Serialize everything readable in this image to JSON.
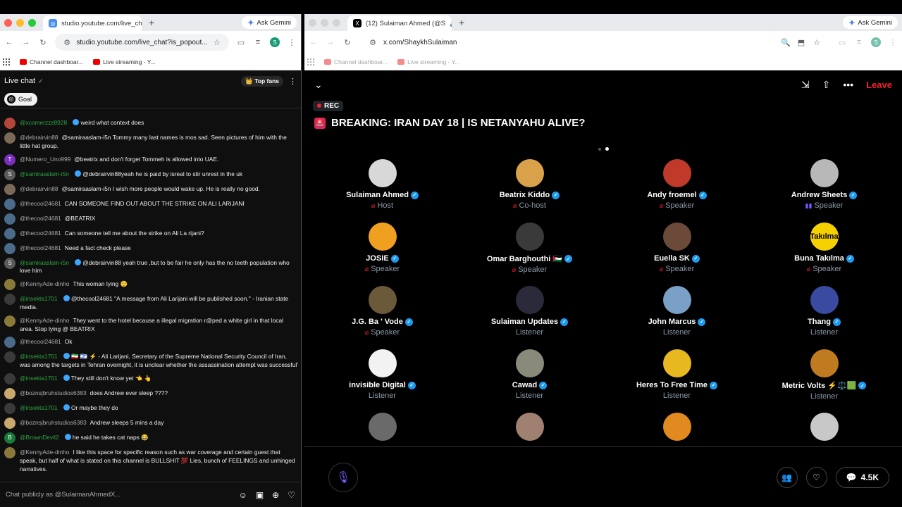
{
  "left_browser": {
    "tab_title": "studio.youtube.com/live_chat",
    "url": "studio.youtube.com/live_chat?is_popout...",
    "ask_gemini": "Ask Gemini",
    "avatar_letter": "S",
    "bookmarks": [
      "Channel dashboar...",
      "Live streaming - Y..."
    ]
  },
  "right_browser": {
    "tab_title": "(12) Sulaiman Ahmed (@S",
    "url": "x.com/ShaykhSulaiman",
    "ask_gemini": "Ask Gemini",
    "avatar_letter": "S",
    "bookmarks": [
      "Channel dashboar...",
      "Live streaming - Y..."
    ]
  },
  "chat": {
    "title": "Live chat",
    "top_fans": "Top fans",
    "goal": "Goal",
    "input_placeholder": "Chat publicly as @SulaimanAhmedX...",
    "messages": [
      {
        "user": "@xcomerzzz8928",
        "green": true,
        "verified": true,
        "text": "weird what context does",
        "color": "#b5463a"
      },
      {
        "user": "@debrairvin88",
        "green": false,
        "verified": false,
        "text": "@samiraaslam-i5n Tommy many last names is mos sad. Seen pictures of him with the little hat group.",
        "color": "#7b6a58"
      },
      {
        "user": "@Numero_Uno999",
        "green": false,
        "verified": false,
        "text": "@beatrix and don't forget Tommeh is allowed into UAE.",
        "color": "#7b2fbe",
        "letter": "T"
      },
      {
        "user": "@samiraaslam-i5n",
        "green": true,
        "verified": true,
        "text": "@debrairvin88yeah he is paid by isreal to stir unrest in the uk",
        "color": "#5a5a5a",
        "letter": "S"
      },
      {
        "user": "@debrairvin88",
        "green": false,
        "verified": false,
        "text": "@samiraaslam-i5n I wish more people would wake up. He is really no good.",
        "color": "#7b6a58"
      },
      {
        "user": "@thecool24681",
        "green": false,
        "verified": false,
        "text": "CAN SOMEONE FIND OUT ABOUT THE STRIKE ON ALI LARIJANI",
        "color": "#4a6b8a"
      },
      {
        "user": "@thecool24681",
        "green": false,
        "verified": false,
        "text": "@BEATRIX",
        "color": "#4a6b8a"
      },
      {
        "user": "@thecool24681",
        "green": false,
        "verified": false,
        "text": "Can someone tell me about the strike on Ali La rijani?",
        "color": "#4a6b8a"
      },
      {
        "user": "@thecool24681",
        "green": false,
        "verified": false,
        "text": "Need a fact check please",
        "color": "#4a6b8a"
      },
      {
        "user": "@samiraaslam-i5n",
        "green": true,
        "verified": true,
        "text": "@debrairvin88 yeah true ,but to be fair he only has the no teeth population who love him",
        "color": "#5a5a5a",
        "letter": "S"
      },
      {
        "user": "@KennyAde-dinho",
        "green": false,
        "verified": false,
        "text": "This woman lying 🤥",
        "color": "#8a7a3a"
      },
      {
        "user": "@insekta1701",
        "green": true,
        "verified": true,
        "text": "@thecool24681 \"A message from Ali Larijani will be published soon.\" - Iranian state media.",
        "color": "#3a3a3a"
      },
      {
        "user": "@KennyAde-dinho",
        "green": false,
        "verified": false,
        "text": "They went to the hotel because a illegal migration r@ped a white girl in that local area. Stop lying @ BEATRIX",
        "color": "#8a7a3a"
      },
      {
        "user": "@thecool24681",
        "green": false,
        "verified": false,
        "text": "Ok",
        "color": "#4a6b8a"
      },
      {
        "user": "@insekta1701",
        "green": true,
        "verified": true,
        "text": "🇮🇷 🇮🇱 ⚡ - Ali Larijani, Secretary of the Supreme National Security Council of Iran, was among the targets in Tehran overnight, it is unclear whether the assassination attempt was successful'",
        "color": "#3a3a3a"
      },
      {
        "user": "@insekta1701",
        "green": true,
        "verified": true,
        "text": "They still don't know yet 👈 👆",
        "color": "#3a3a3a"
      },
      {
        "user": "@boznsjbruhstudios6383",
        "green": false,
        "verified": false,
        "text": "does Andrew ever sleep ????",
        "color": "#c9a96e"
      },
      {
        "user": "@insekta1701",
        "green": true,
        "verified": true,
        "text": "Or maybe they do",
        "color": "#3a3a3a"
      },
      {
        "user": "@boznsjbruhstudios6383",
        "green": false,
        "verified": false,
        "text": "Andrew sleeps 5 mins a day",
        "color": "#c9a96e"
      },
      {
        "user": "@BrownDevil2",
        "green": true,
        "verified": true,
        "text": "he said he takes cat naps 😂",
        "color": "#1a7a3a",
        "letter": "B"
      },
      {
        "user": "@KennyAde-dinho",
        "green": false,
        "verified": false,
        "text": "I like this space for specific reason such as war coverage and certain guest that speak, but half of what is stated on this channel is BULLSHIT 💯 Lies, bunch of FEELINGS and unhinged narratives.",
        "color": "#8a7a3a"
      }
    ]
  },
  "space": {
    "leave": "Leave",
    "rec": "REC",
    "title": "BREAKING: IRAN DAY 18 | IS NETANYAHU ALIVE?",
    "listener_count": "4.5K",
    "people": [
      {
        "name": "Sulaiman Ahmed",
        "role": "Host",
        "role_icon": "mic-off",
        "color": "#d8d8d8"
      },
      {
        "name": "Beatrix Kiddo",
        "role": "Co-host",
        "role_icon": "mic-off",
        "color": "#d9a24a"
      },
      {
        "name": "Andy froemel",
        "role": "Speaker",
        "role_icon": "mic-off",
        "color": "#c03a2a"
      },
      {
        "name": "Andrew Sheets",
        "role": "Speaker",
        "role_icon": "speaking",
        "color": "#b8b8b8"
      },
      {
        "name": "JOSIE",
        "role": "Speaker",
        "role_icon": "mic-off",
        "color": "#f0a020"
      },
      {
        "name": "Omar Barghouthi 🇵🇸",
        "role": "Speaker",
        "role_icon": "mic-off",
        "color": "#3a3a3a"
      },
      {
        "name": "Euella SK",
        "role": "Speaker",
        "role_icon": "mic-off",
        "color": "#6b4a3a"
      },
      {
        "name": "Buna Takılma",
        "role": "Speaker",
        "role_icon": "mic-off",
        "color": "#f5d000",
        "avatar_text": "Takılma"
      },
      {
        "name": "J.G. Ba ' Vode",
        "role": "Speaker",
        "role_icon": "mic-off",
        "color": "#6a5a3a"
      },
      {
        "name": "Sulaiman Updates",
        "role": "Listener",
        "role_icon": "",
        "color": "#2a2a3a"
      },
      {
        "name": "John Marcus",
        "role": "Listener",
        "role_icon": "",
        "color": "#7aa0c8"
      },
      {
        "name": "Thang",
        "role": "Listener",
        "role_icon": "",
        "color": "#3a4aa0"
      },
      {
        "name": "invisible Digital",
        "role": "Listener",
        "role_icon": "",
        "color": "#f2f2f2"
      },
      {
        "name": "Cawad",
        "role": "Listener",
        "role_icon": "",
        "color": "#8a8a7a"
      },
      {
        "name": "Heres To Free Time",
        "role": "Listener",
        "role_icon": "",
        "color": "#e8b820"
      },
      {
        "name": "Metric Volts ⚡⚖️🟩",
        "role": "Listener",
        "role_icon": "",
        "color": "#c07a20"
      },
      {
        "name": "",
        "role": "",
        "role_icon": "",
        "color": "#6a6a6a"
      },
      {
        "name": "",
        "role": "",
        "role_icon": "",
        "color": "#a08070"
      },
      {
        "name": "",
        "role": "",
        "role_icon": "",
        "color": "#e08a20"
      },
      {
        "name": "",
        "role": "",
        "role_icon": "",
        "color": "#c8c8c8"
      }
    ]
  }
}
